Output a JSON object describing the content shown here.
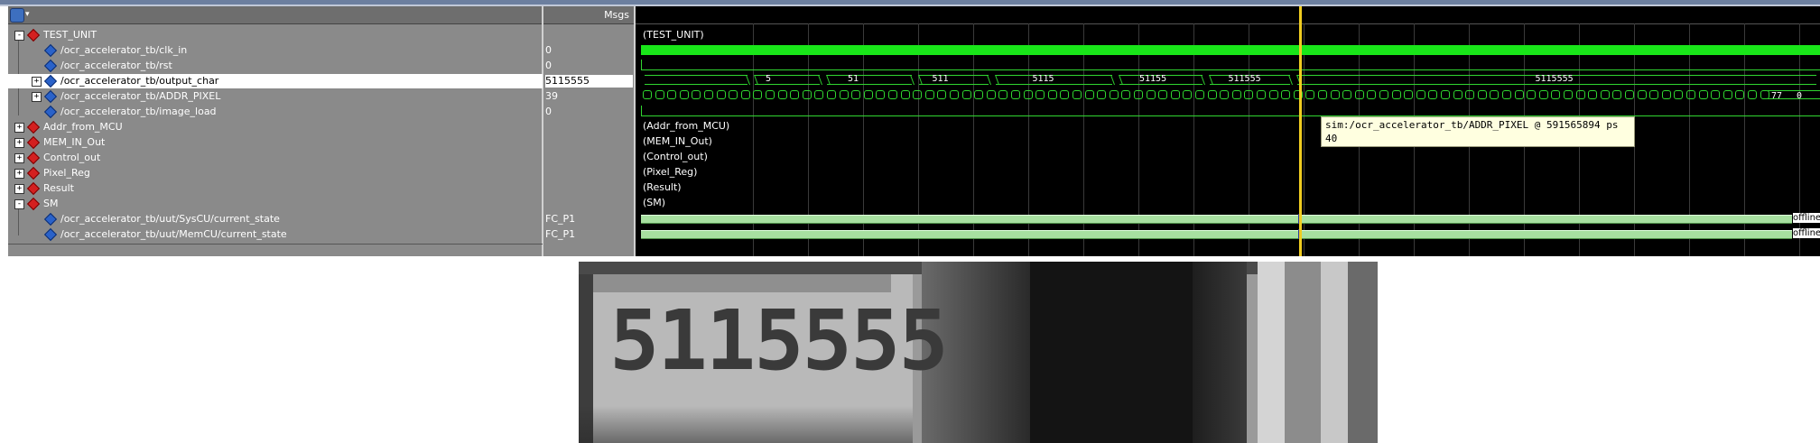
{
  "toolbar": {
    "icon": "wave-window-icon",
    "dropdown_icon": "chevron-down-icon"
  },
  "columns": {
    "msgs": "Msgs"
  },
  "signals": [
    {
      "name": "TEST_UNIT",
      "value": "",
      "group": true,
      "expand": "-"
    },
    {
      "name": "/ocr_accelerator_tb/clk_in",
      "value": "0"
    },
    {
      "name": "/ocr_accelerator_tb/rst",
      "value": "0"
    },
    {
      "name": "/ocr_accelerator_tb/output_char",
      "value": "5115555",
      "expand": "+",
      "selected": true
    },
    {
      "name": "/ocr_accelerator_tb/ADDR_PIXEL",
      "value": "39",
      "expand": "+"
    },
    {
      "name": "/ocr_accelerator_tb/image_load",
      "value": "0"
    },
    {
      "name": "Addr_from_MCU",
      "value": "",
      "group": true,
      "expand": "+"
    },
    {
      "name": "MEM_IN_Out",
      "value": "",
      "group": true,
      "expand": "+"
    },
    {
      "name": "Control_out",
      "value": "",
      "group": true,
      "expand": "+"
    },
    {
      "name": "Pixel_Reg",
      "value": "",
      "group": true,
      "expand": "+"
    },
    {
      "name": "Result",
      "value": "",
      "group": true,
      "expand": "+"
    },
    {
      "name": "SM",
      "value": "",
      "group": true,
      "expand": "-"
    },
    {
      "name": "/ocr_accelerator_tb/uut/SysCU/current_state",
      "value": "FC_P1"
    },
    {
      "name": "/ocr_accelerator_tb/uut/MemCU/current_state",
      "value": "FC_P1"
    }
  ],
  "wave": {
    "group_labels": [
      "(TEST_UNIT)",
      "(Addr_from_MCU)",
      "(MEM_IN_Out)",
      "(Control_out)",
      "(Pixel_Reg)",
      "(Result)",
      "(SM)"
    ],
    "output_char_values": [
      "5",
      "51",
      "511",
      "5115",
      "51155",
      "511555",
      "5115555"
    ],
    "addr_end_values": [
      "77",
      "0"
    ],
    "offline_label": "offline"
  },
  "tooltip": {
    "line1": "sim:/ocr_accelerator_tb/ADDR_PIXEL @ 591565894 ps",
    "line2": "40"
  },
  "image": {
    "digits": "5115555"
  },
  "colors": {
    "accent_cursor": "#f0cc20",
    "clock_green": "#19e619",
    "state_green": "#a7e0a0"
  }
}
